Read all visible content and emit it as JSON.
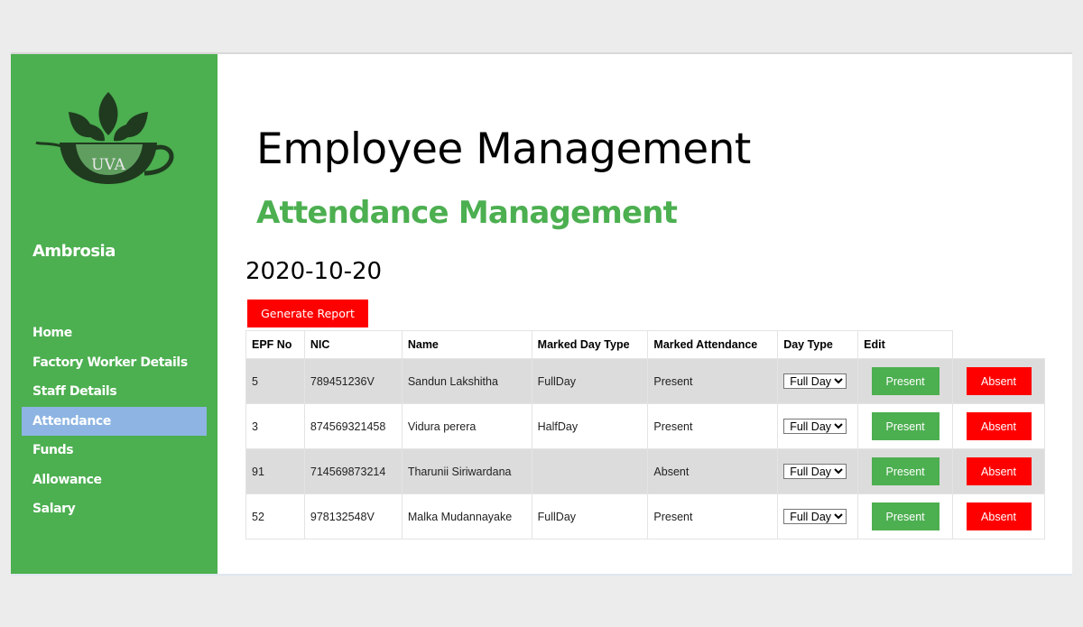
{
  "sidebar": {
    "logo_text": "UVA",
    "brand": "Ambrosia",
    "items": [
      {
        "label": "Home"
      },
      {
        "label": "Factory Worker Details"
      },
      {
        "label": "Staff Details"
      },
      {
        "label": "Attendance",
        "active": true
      },
      {
        "label": "Funds"
      },
      {
        "label": "Allowance"
      },
      {
        "label": "Salary"
      }
    ]
  },
  "header": {
    "title": "Employee Management",
    "subtitle": "Attendance Management"
  },
  "date": "2020-10-20",
  "generate_report_label": "Generate Report",
  "table": {
    "headers": [
      "EPF No",
      "NIC",
      "Name",
      "Marked Day Type",
      "Marked Attendance",
      "Day Type",
      "Edit"
    ],
    "rows": [
      {
        "epf": "5",
        "nic": "789451236V",
        "name": "Sandun Lakshitha",
        "marked_day_type": "FullDay",
        "marked_attendance": "Present",
        "day_type": "Full Day",
        "present_label": "Present",
        "absent_label": "Absent"
      },
      {
        "epf": "3",
        "nic": "874569321458",
        "name": "Vidura perera",
        "marked_day_type": "HalfDay",
        "marked_attendance": "Present",
        "day_type": "Full Day",
        "present_label": "Present",
        "absent_label": "Absent"
      },
      {
        "epf": "91",
        "nic": "714569873214",
        "name": "Tharunii Siriwardana",
        "marked_day_type": "",
        "marked_attendance": "Absent",
        "day_type": "Full Day",
        "present_label": "Present",
        "absent_label": "Absent"
      },
      {
        "epf": "52",
        "nic": "978132548V",
        "name": "Malka Mudannayake",
        "marked_day_type": "FullDay",
        "marked_attendance": "Present",
        "day_type": "Full Day",
        "present_label": "Present",
        "absent_label": "Absent"
      }
    ]
  },
  "colors": {
    "sidebar_bg": "#4caf50",
    "active_nav": "#8db4e2",
    "accent_green": "#4caf50",
    "danger_red": "#ff0000",
    "shaded_row": "#dcdcdc"
  }
}
